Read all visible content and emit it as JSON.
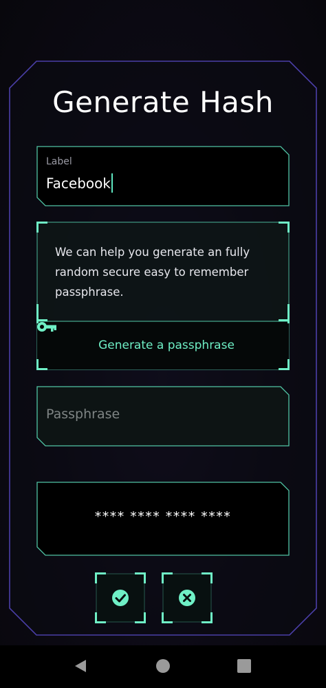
{
  "title": "Generate Hash",
  "label_field": {
    "caption": "Label",
    "value": "Facebook"
  },
  "info": {
    "text": "We can help you generate an fully random secure easy to remember passphrase.",
    "button_label": "Generate a passphrase",
    "button_icon": "key-icon"
  },
  "passphrase_field": {
    "placeholder": "Passphrase"
  },
  "hash_display": {
    "value": "**** **** **** ****"
  },
  "actions": {
    "confirm_icon": "check-circle-icon",
    "cancel_icon": "x-circle-icon"
  },
  "colors": {
    "accent": "#5ee6c0",
    "panel_border": "#4b3fa8",
    "background": "#0a0910"
  }
}
